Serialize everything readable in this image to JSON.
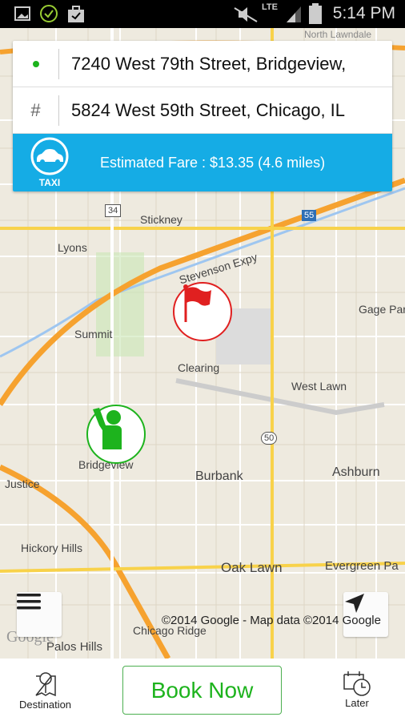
{
  "status_bar": {
    "time": "5:14 PM",
    "network": "LTE"
  },
  "route": {
    "pickup": "7240 West 79th Street, Bridgeview,",
    "destination": "5824 West 59th Street, Chicago, IL",
    "destination_icon": "#"
  },
  "fare": {
    "service_label": "TAXI",
    "text": "Estimated Fare : $13.35 (4.6 miles)"
  },
  "map": {
    "labels": [
      "Stickney",
      "Lyons",
      "Stevenson Expy",
      "Summit",
      "Clearing",
      "Gage Par",
      "West Lawn",
      "Bridgeview",
      "Burbank",
      "Ashburn",
      "Justice",
      "Hickory Hills",
      "Oak Lawn",
      "Evergreen Pa",
      "Chicago Ridge",
      "Palos Hills",
      "North Lawndale"
    ],
    "shields": [
      "34",
      "55",
      "50"
    ],
    "copyright": "©2014 Google - Map data ©2014 Google",
    "logo": "Google"
  },
  "bottom_bar": {
    "destination_label": "Destination",
    "book_label": "Book Now",
    "later_label": "Later"
  },
  "colors": {
    "accent_blue": "#15ace5",
    "green": "#1db31d",
    "flag_red": "#e02020"
  }
}
